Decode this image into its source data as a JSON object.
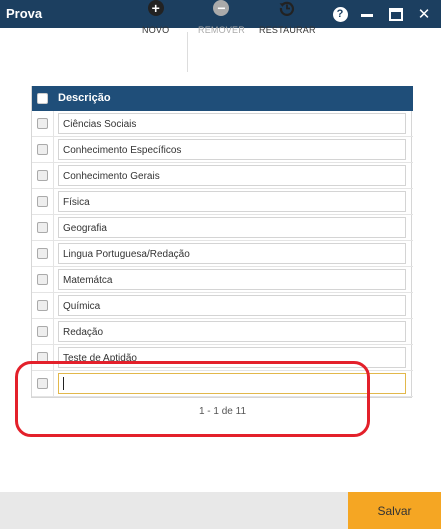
{
  "window": {
    "title": "Prova"
  },
  "titlebar": {
    "help_glyph": "?",
    "close_glyph": "✕"
  },
  "toolbar": {
    "new_label": "NOVO",
    "remove_label": "REMOVER",
    "restore_label": "RESTAURAR",
    "new_glyph": "+",
    "remove_glyph": "−"
  },
  "grid": {
    "header": "Descrição",
    "rows": [
      "Ciências Sociais",
      "Conhecimento Específicos",
      "Conhecimento Gerais",
      "Física",
      "Geografia",
      "Lingua Portuguesa/Redação",
      "Matemátca",
      "Química",
      "Redação",
      "Teste de Aptidão"
    ],
    "new_row_value": ""
  },
  "pager": {
    "text": "1 - 1 de 11"
  },
  "footer": {
    "save_label": "Salvar"
  },
  "colors": {
    "titlebar": "#1c3f60",
    "header": "#1f4e79",
    "save": "#f5a623",
    "highlight": "#e3202a"
  }
}
